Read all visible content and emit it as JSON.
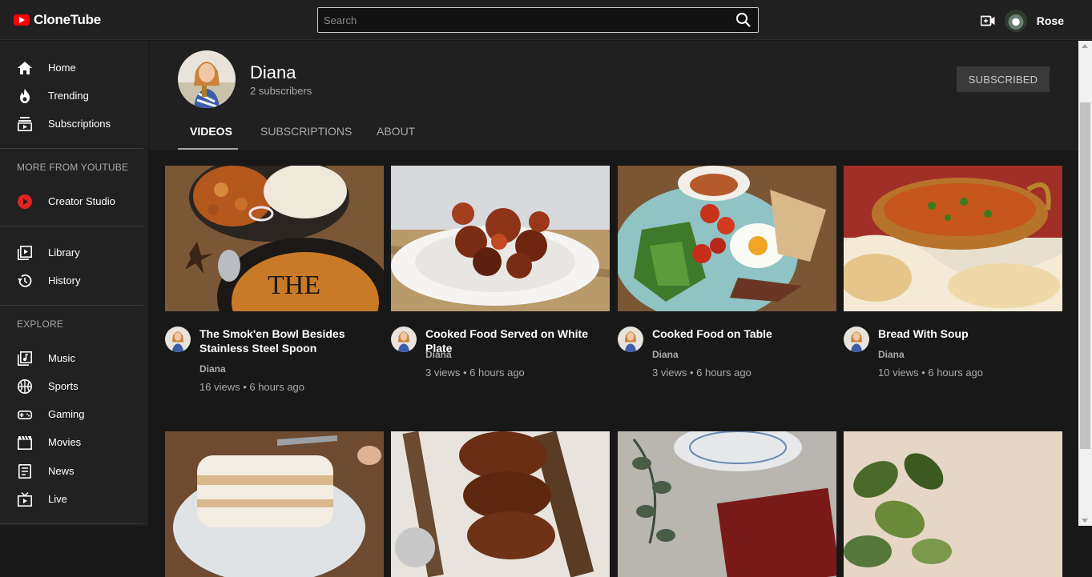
{
  "app": {
    "name": "CloneTube"
  },
  "search": {
    "placeholder": "Search"
  },
  "user": {
    "name": "Rose"
  },
  "sidebar": {
    "main": [
      {
        "label": "Home",
        "icon": "home-icon"
      },
      {
        "label": "Trending",
        "icon": "fire-icon"
      },
      {
        "label": "Subscriptions",
        "icon": "subscriptions-icon"
      }
    ],
    "more_heading": "MORE FROM YOUTUBE",
    "more": [
      {
        "label": "Creator Studio",
        "icon": "play-circle-icon"
      }
    ],
    "library": [
      {
        "label": "Library",
        "icon": "library-icon"
      },
      {
        "label": "History",
        "icon": "history-icon"
      }
    ],
    "explore_heading": "EXPLORE",
    "explore": [
      {
        "label": "Music",
        "icon": "music-icon"
      },
      {
        "label": "Sports",
        "icon": "sports-icon"
      },
      {
        "label": "Gaming",
        "icon": "gamepad-icon"
      },
      {
        "label": "Movies",
        "icon": "movie-icon"
      },
      {
        "label": "News",
        "icon": "news-icon"
      },
      {
        "label": "Live",
        "icon": "live-icon"
      }
    ]
  },
  "channel": {
    "name": "Diana",
    "subscribers": "2 subscribers",
    "subscribe_label": "SUBSCRIBED",
    "tabs": [
      "VIDEOS",
      "SUBSCRIPTIONS",
      "ABOUT"
    ],
    "active_tab": "VIDEOS"
  },
  "videos": [
    {
      "title": "The Smok'en Bowl Besides Stainless Steel Spoon",
      "channel": "Diana",
      "stats": "16 views • 6 hours ago"
    },
    {
      "title": "Cooked Food Served on White Plate",
      "channel": "Diana",
      "stats": "3 views • 6 hours ago"
    },
    {
      "title": "Cooked Food on Table",
      "channel": "Diana",
      "stats": "3 views • 6 hours ago"
    },
    {
      "title": "Bread With Soup",
      "channel": "Diana",
      "stats": "10 views • 6 hours ago"
    },
    {
      "title": "",
      "channel": "",
      "stats": ""
    },
    {
      "title": "",
      "channel": "",
      "stats": ""
    },
    {
      "title": "",
      "channel": "",
      "stats": ""
    },
    {
      "title": "",
      "channel": "",
      "stats": ""
    }
  ],
  "colors": {
    "brand": "#ff0000",
    "background": "#181818",
    "panel": "#212121"
  }
}
